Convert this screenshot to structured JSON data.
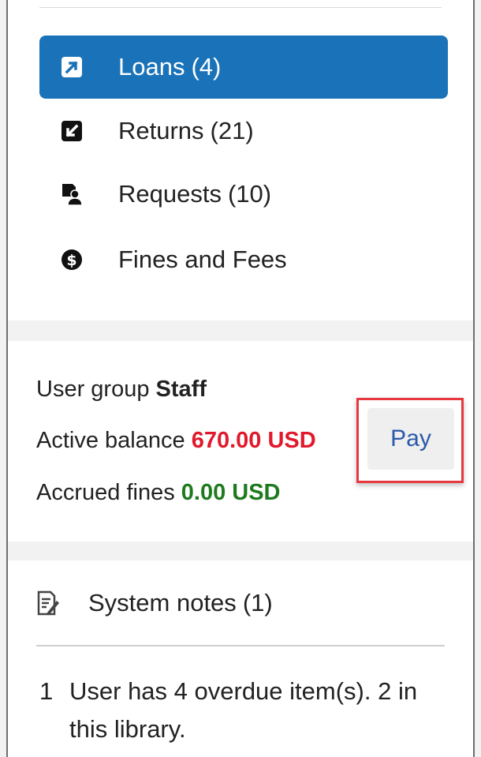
{
  "nav": {
    "items": [
      {
        "label": "Loans",
        "count": "(4)",
        "icon": "loan-arrow-icon",
        "active": true
      },
      {
        "label": "Returns",
        "count": "(21)",
        "icon": "return-arrow-icon",
        "active": false
      },
      {
        "label": "Requests",
        "count": "(10)",
        "icon": "requests-user-icon",
        "active": false
      },
      {
        "label": "Fines and Fees",
        "count": "",
        "icon": "dollar-circle-icon",
        "active": false
      }
    ],
    "active_color": "#1a73b8"
  },
  "balance": {
    "user_group_label": "User group",
    "user_group_value": "Staff",
    "active_balance_label": "Active balance",
    "active_balance_value": "670.00 USD",
    "accrued_fines_label": "Accrued fines",
    "accrued_fines_value": "0.00 USD",
    "pay_label": "Pay",
    "balance_color": "#e0192c",
    "fines_color": "#1f7a1f",
    "highlight_color": "#e8383f"
  },
  "notes": {
    "title": "System notes",
    "count": "(1)",
    "icon": "notes-edit-icon",
    "items": [
      {
        "number": "1",
        "text": "User has 4 overdue item(s). 2 in this library."
      }
    ]
  }
}
